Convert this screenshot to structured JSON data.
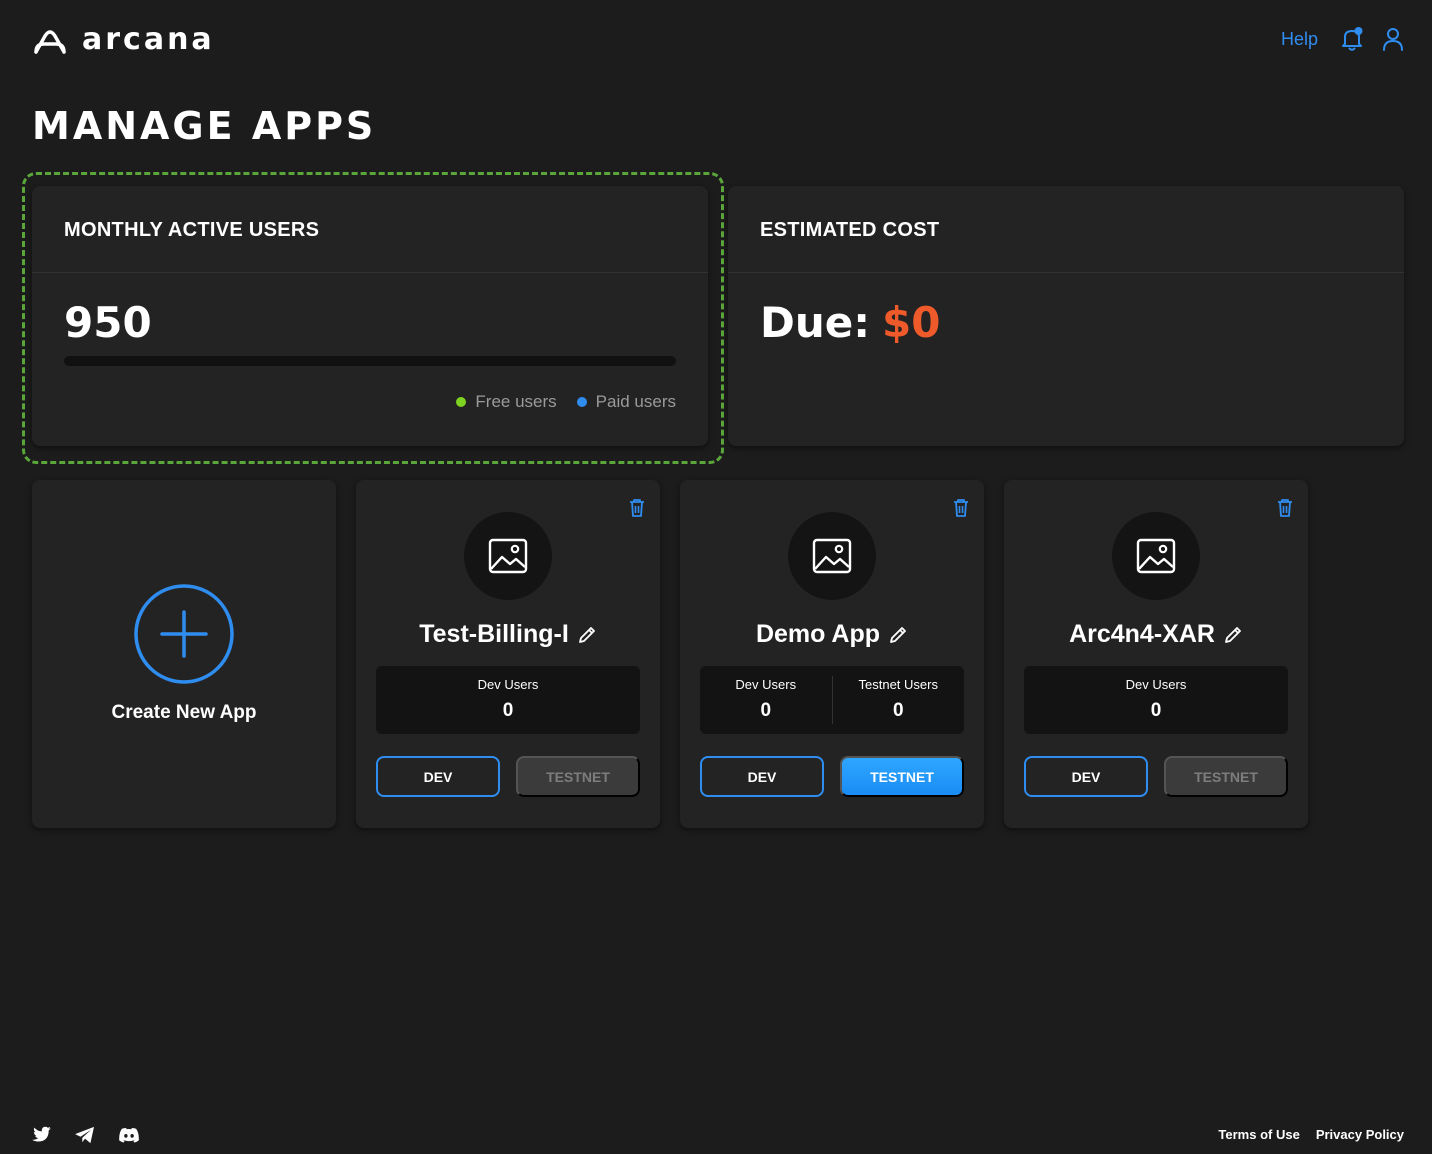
{
  "header": {
    "logo_text": "arcana",
    "help_label": "Help"
  },
  "page": {
    "title": "MANAGE APPS"
  },
  "mau_panel": {
    "title": "MONTHLY ACTIVE USERS",
    "value": "950",
    "bar_fill_percent": 0,
    "legend": {
      "free": "Free users",
      "paid": "Paid users"
    }
  },
  "cost_panel": {
    "title": "ESTIMATED COST",
    "due_label": "Due:",
    "due_amount": "$0"
  },
  "create_card": {
    "label": "Create New App"
  },
  "apps": [
    {
      "name": "Test-Billing-I",
      "columns": [
        {
          "label": "Dev Users",
          "value": "0"
        }
      ],
      "dev_label": "DEV",
      "testnet_label": "TESTNET",
      "testnet_active": false
    },
    {
      "name": "Demo App",
      "columns": [
        {
          "label": "Dev Users",
          "value": "0"
        },
        {
          "label": "Testnet Users",
          "value": "0"
        }
      ],
      "dev_label": "DEV",
      "testnet_label": "TESTNET",
      "testnet_active": true
    },
    {
      "name": "Arc4n4-XAR",
      "columns": [
        {
          "label": "Dev Users",
          "value": "0"
        }
      ],
      "dev_label": "DEV",
      "testnet_label": "TESTNET",
      "testnet_active": false
    }
  ],
  "footer": {
    "terms_label": "Terms of Use",
    "privacy_label": "Privacy Policy"
  },
  "colors": {
    "accent": "#2f8df0",
    "due_amount": "#ef5a2a",
    "highlight": "#5ba63b",
    "free_dot": "#7ed321"
  }
}
